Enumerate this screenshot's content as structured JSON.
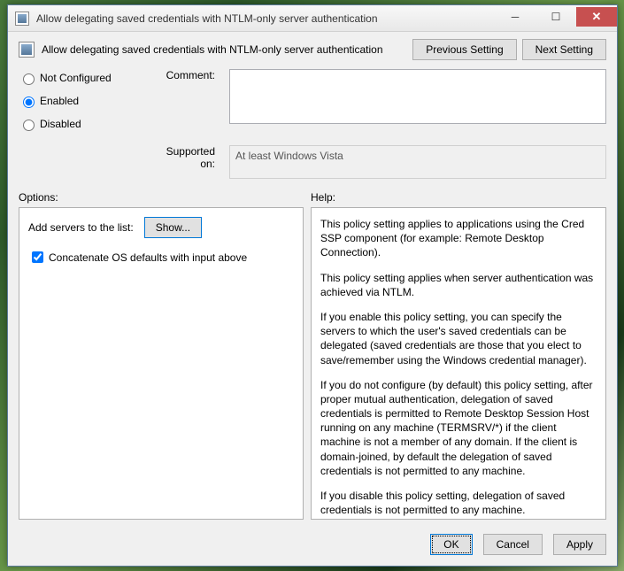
{
  "window": {
    "title": "Allow delegating saved credentials with NTLM-only server authentication"
  },
  "header": {
    "title": "Allow delegating saved credentials with NTLM-only server authentication",
    "previous_setting": "Previous Setting",
    "next_setting": "Next Setting"
  },
  "config": {
    "radios": {
      "not_configured": "Not Configured",
      "enabled": "Enabled",
      "disabled": "Disabled",
      "selected": "enabled"
    },
    "comment_label": "Comment:",
    "comment_value": "",
    "supported_label": "Supported on:",
    "supported_value": "At least Windows Vista"
  },
  "labels": {
    "options": "Options:",
    "help": "Help:"
  },
  "options": {
    "add_servers_label": "Add servers to the list:",
    "show_button": "Show...",
    "concatenate_checked": true,
    "concatenate_label": "Concatenate OS defaults with input above"
  },
  "help": {
    "p1": "This policy setting applies to applications using the Cred SSP component (for example: Remote Desktop Connection).",
    "p2": "This policy setting applies when server authentication was achieved via NTLM.",
    "p3": "If you enable this policy setting, you can specify the servers to which the user's saved credentials can be delegated (saved credentials are those that you elect to save/remember using the Windows credential manager).",
    "p4": "If you do not configure (by default) this policy setting, after proper mutual authentication, delegation of saved credentials is permitted to Remote Desktop Session Host running on any machine (TERMSRV/*) if the client machine is not a member of any domain. If the client is domain-joined, by default the delegation of saved credentials is not permitted to any machine.",
    "p5": "If you disable this policy setting, delegation of saved credentials is not permitted to any machine."
  },
  "footer": {
    "ok": "OK",
    "cancel": "Cancel",
    "apply": "Apply"
  }
}
